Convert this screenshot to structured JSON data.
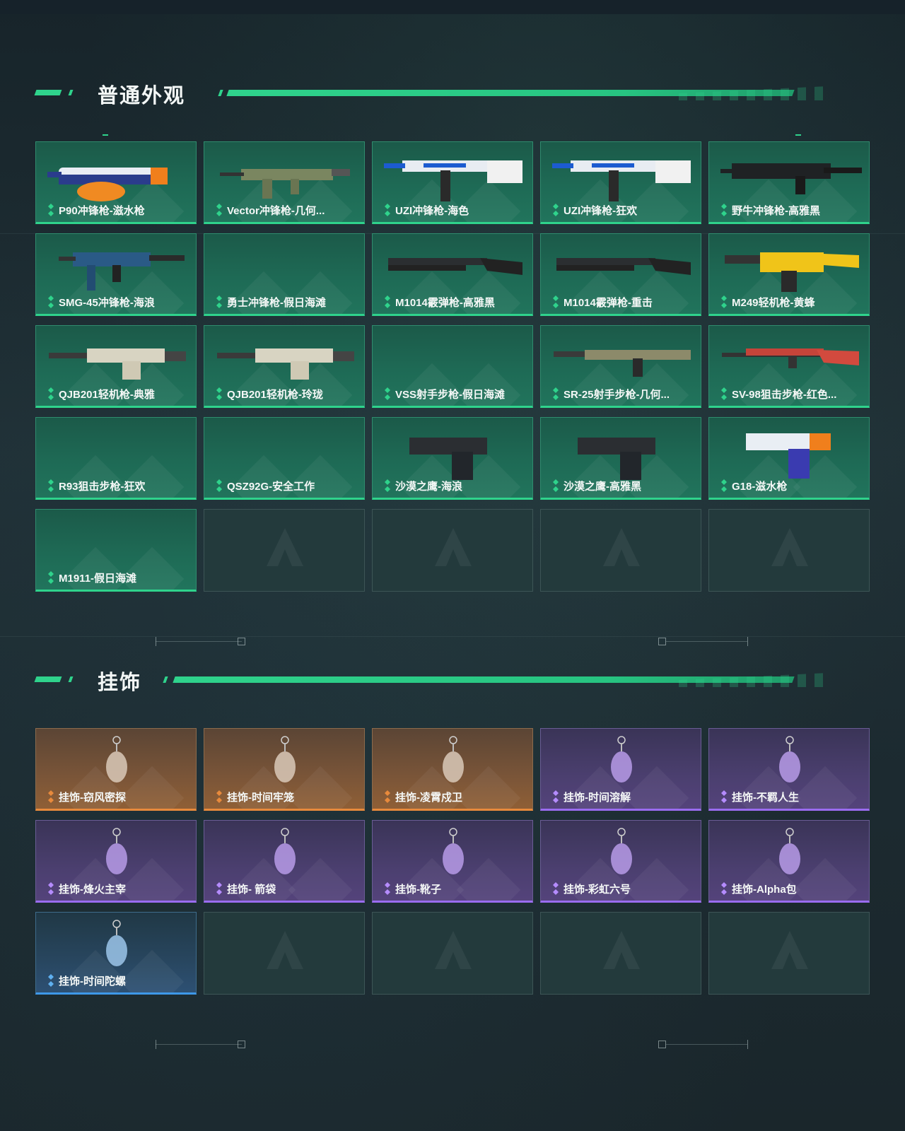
{
  "sections": {
    "skins": {
      "title": "普通外观"
    },
    "charms": {
      "title": "挂饰"
    }
  },
  "skins": [
    {
      "label": "P90冲锋枪-滋水枪",
      "icon": "p90-water-gun-icon",
      "weapon": "smg"
    },
    {
      "label": "Vector冲锋枪-几何...",
      "icon": "vector-geometry-icon",
      "weapon": "vector"
    },
    {
      "label": "UZI冲锋枪-海色",
      "icon": "uzi-sea-color-icon",
      "weapon": "uzi"
    },
    {
      "label": "UZI冲锋枪-狂欢",
      "icon": "uzi-carnival-icon",
      "weapon": "uzi"
    },
    {
      "label": "野牛冲锋枪-高雅黑",
      "icon": "bizon-elegant-black-icon",
      "weapon": "bizon"
    },
    {
      "label": "SMG-45冲锋枪-海浪",
      "icon": "smg45-waves-icon",
      "weapon": "smg45"
    },
    {
      "label": "勇士冲锋枪-假日海滩",
      "icon": "",
      "weapon": "none"
    },
    {
      "label": "M1014霰弹枪-高雅黑",
      "icon": "m1014-elegant-black-icon",
      "weapon": "shotgun"
    },
    {
      "label": "M1014霰弹枪-重击",
      "icon": "m1014-heavy-strike-icon",
      "weapon": "shotgun"
    },
    {
      "label": "M249轻机枪-黄蜂",
      "icon": "m249-hornet-icon",
      "weapon": "lmg"
    },
    {
      "label": "QJB201轻机枪-典雅",
      "icon": "qjb201-classic-icon",
      "weapon": "lmg2"
    },
    {
      "label": "QJB201轻机枪-玲珑",
      "icon": "qjb201-exquisite-icon",
      "weapon": "lmg2"
    },
    {
      "label": "VSS射手步枪-假日海滩",
      "icon": "",
      "weapon": "none"
    },
    {
      "label": "SR-25射手步枪-几何...",
      "icon": "sr25-geometry-icon",
      "weapon": "rifle"
    },
    {
      "label": "SV-98狙击步枪-红色...",
      "icon": "sv98-red-icon",
      "weapon": "sniper"
    },
    {
      "label": "R93狙击步枪-狂欢",
      "icon": "",
      "weapon": "none"
    },
    {
      "label": "QSZ92G-安全工作",
      "icon": "",
      "weapon": "none"
    },
    {
      "label": "沙漠之鹰-海浪",
      "icon": "desert-eagle-waves-icon",
      "weapon": "pistol"
    },
    {
      "label": "沙漠之鹰-高雅黑",
      "icon": "desert-eagle-black-icon",
      "weapon": "pistol"
    },
    {
      "label": "G18-滋水枪",
      "icon": "g18-water-gun-icon",
      "weapon": "glock"
    },
    {
      "label": "M1911-假日海滩",
      "icon": "",
      "weapon": "none"
    }
  ],
  "charms": [
    {
      "label": "挂饰-窃风密探",
      "rarity": "orange",
      "icon": "wind-thief-spy-charm-icon"
    },
    {
      "label": "挂饰-时间牢笼",
      "rarity": "orange",
      "icon": "time-cage-charm-icon"
    },
    {
      "label": "挂饰-凌霄戍卫",
      "rarity": "orange",
      "icon": "sky-guardian-charm-icon"
    },
    {
      "label": "挂饰-时间溶解",
      "rarity": "purple",
      "icon": "time-dissolve-charm-icon"
    },
    {
      "label": "挂饰-不羁人生",
      "rarity": "purple",
      "icon": "sneaker-charm-icon"
    },
    {
      "label": "挂饰-烽火主宰",
      "rarity": "purple",
      "icon": "container-charm-icon"
    },
    {
      "label": "挂饰- 箭袋",
      "rarity": "purple",
      "icon": "quiver-charm-icon"
    },
    {
      "label": "挂饰-靴子",
      "rarity": "purple",
      "icon": "boot-charm-icon"
    },
    {
      "label": "挂饰-彩虹六号",
      "rarity": "purple",
      "icon": "rainbow-six-charm-icon"
    },
    {
      "label": "挂饰-Alpha包",
      "rarity": "purple",
      "icon": "alpha-bag-charm-icon"
    },
    {
      "label": "挂饰-时间陀螺",
      "rarity": "blue",
      "icon": "time-top-charm-icon"
    }
  ],
  "empty_slots": {
    "skins": 4,
    "charms": 4
  },
  "colors": {
    "accent": "#2fd38c",
    "orange": "#e88a3c",
    "purple": "#9a6cf0",
    "blue": "#3e98e8"
  }
}
